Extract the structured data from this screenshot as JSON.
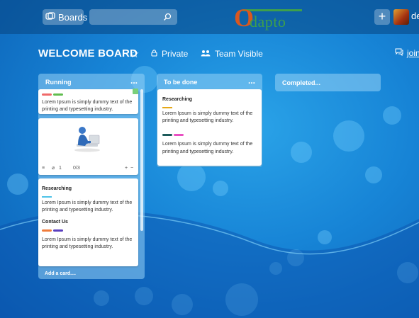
{
  "topbar": {
    "boards_label": "Boards",
    "search_placeholder": "",
    "logo_first": "O",
    "logo_rest": "dapto",
    "add_label": "+",
    "user_text": "de"
  },
  "board": {
    "title": "WELCOME BOARD",
    "privacy": "Private",
    "visibility": "Team Visible",
    "join": "join"
  },
  "colors": {
    "label_red": "#f06a6a",
    "label_green": "#61bd4f",
    "label_yellow": "#e6a817",
    "label_cyan": "#4fc3e8",
    "label_darkteal": "#1c5a5a",
    "label_pink": "#e94fc2",
    "label_orange": "#f07c3c",
    "label_purple": "#5a3fbf"
  },
  "lists": [
    {
      "title": "Running",
      "menu": "...",
      "add_card": "Add a card....",
      "cards": [
        {
          "text": "Lorem Ipsum is simply dummy text of the printing and typesetting industry."
        },
        {
          "attachments": "1",
          "checklist": "0/3",
          "plus": "+",
          "minus": "−"
        },
        {
          "title1": "Researching",
          "text1": "Lorem Ipsum is simply dummy text of the printing and typesetting industry.",
          "title2": "Contact Us",
          "text2": "Lorem Ipsum is simply dummy text of the printing and typesetting industry."
        }
      ]
    },
    {
      "title": "To be done",
      "menu": "...",
      "cards": [
        {
          "title": "Researching",
          "text1": "Lorem Ipsum is simply dummy text of the printing and typesetting industry.",
          "text2": "Lorem Ipsum is simply dummy text of the printing and typesetting industry."
        }
      ]
    },
    {
      "title": "Completed..."
    }
  ]
}
